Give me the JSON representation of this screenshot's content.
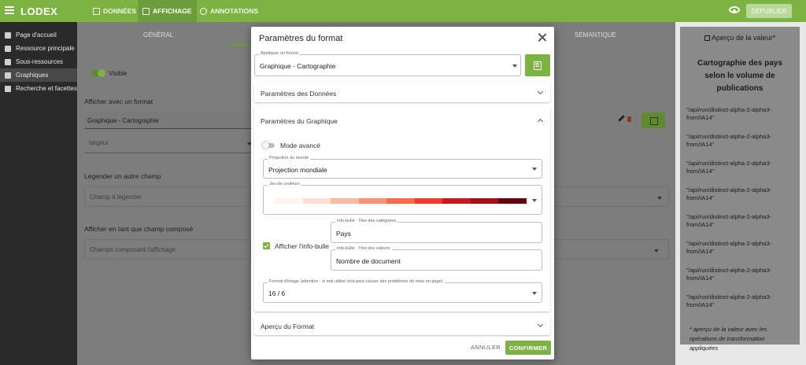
{
  "app": {
    "brand": "LODEX"
  },
  "nav": {
    "tabs": [
      {
        "label": "DONNÉES",
        "icon": "list-icon"
      },
      {
        "label": "AFFICHAGE",
        "icon": "display-icon"
      },
      {
        "label": "ANNOTATIONS",
        "icon": "chat-icon"
      }
    ],
    "publish_label": "DÉPUBLIER"
  },
  "sidebar": {
    "items": [
      {
        "label": "Page d'accueil",
        "icon": "home-icon"
      },
      {
        "label": "Ressource principale",
        "icon": "document-icon"
      },
      {
        "label": "Sous-ressources",
        "icon": "subresource-icon"
      },
      {
        "label": "Graphiques",
        "icon": "bar-chart-icon"
      },
      {
        "label": "Recherche et facettes",
        "icon": "search-icon"
      }
    ]
  },
  "background": {
    "tabs": {
      "general": "GÉNÉRAL",
      "semantic": "SÉMANTIQUE"
    },
    "visible_label": "Visible",
    "format_heading": "Afficher avec un format",
    "format_value": "Graphique - Cartographie",
    "width_placeholder": "largeur",
    "legend_heading": "Légender un autre champ",
    "legend_placeholder": "Champ à légender",
    "composed_heading": "Afficher en tant que champ composé",
    "composed_placeholder": "Champs composant l'affichage"
  },
  "preview": {
    "header": "Aperçu de la valeur*",
    "title": "Cartographie des pays selon le volume de publications",
    "items": [
      "\"/api/run/distinct-alpha-2-alpha3-from/IA14\"",
      "\"/api/run/distinct-alpha-2-alpha3-from/IA14\"",
      "\"/api/run/distinct-alpha-2-alpha3-from/IA14\"",
      "\"/api/run/distinct-alpha-2-alpha3-from/IA14\"",
      "\"/api/run/distinct-alpha-2-alpha3-from/IA14\"",
      "\"/api/run/distinct-alpha-2-alpha3-from/IA14\"",
      "\"/api/run/distinct-alpha-2-alpha3-from/IA14\"",
      "\"/api/run/distinct-alpha-2-alpha3-from/IA14\""
    ],
    "note": "* aperçu de la valeur avec les opérations de transformation appliquées"
  },
  "modal": {
    "title": "Paramètres du format",
    "apply_format_label": "Appliquer un format",
    "apply_format_value": "Graphique - Cartographie",
    "data_params_title": "Paramètres des Données",
    "chart_params_title": "Paramètres du Graphique",
    "advanced_mode_label": "Mode avancé",
    "projection_label": "Projection du monde",
    "projection_value": "Projection mondiale",
    "color_set_label": "Jeu de couleurs",
    "color_swatches": [
      "#fff5f0",
      "#fee0d2",
      "#fcbba1",
      "#fc9272",
      "#fb6a4a",
      "#ef3b2c",
      "#cb181d",
      "#a50f15",
      "#67000d"
    ],
    "tooltip_label": "Afficher l'info-bulle",
    "tooltip_category_label": "Info-bulle : Titre des catégories",
    "tooltip_category_value": "Pays",
    "tooltip_value_label": "Info-bulle : Titre des valeurs",
    "tooltip_value_value": "Nombre de document",
    "image_format_label": "Format d'image (attention : si mal utilisé cela peut causer des problèmes de mise en page)",
    "image_format_value": "16 / 6",
    "format_preview_title": "Aperçu du Format",
    "cancel_label": "ANNULER",
    "confirm_label": "CONFIRMER"
  }
}
